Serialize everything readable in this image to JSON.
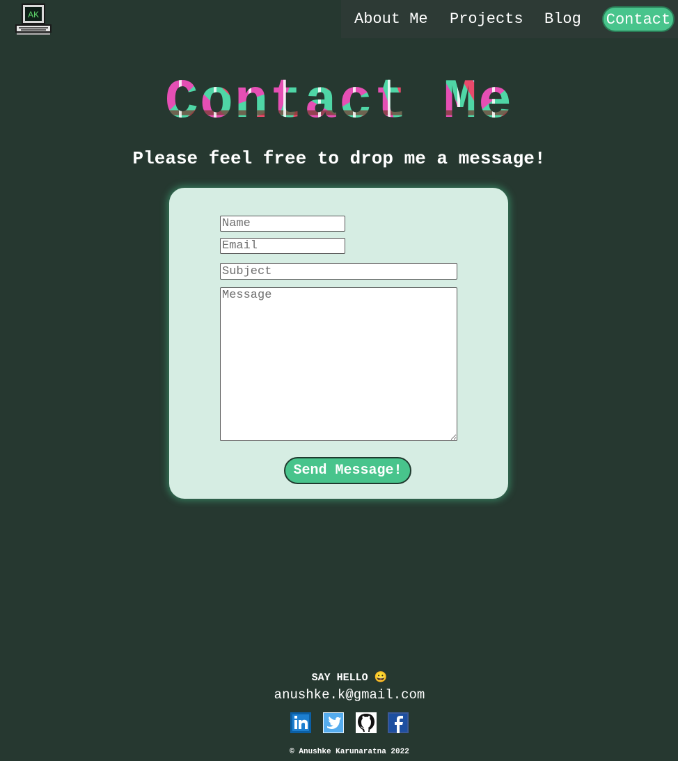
{
  "navbar": {
    "logo_text": "AK",
    "links": [
      {
        "label": "About Me"
      },
      {
        "label": "Projects"
      },
      {
        "label": "Blog"
      },
      {
        "label": "Contact",
        "active": true
      }
    ]
  },
  "hero": {
    "title": "Contact Me",
    "subtitle": "Please feel free to drop me a message!"
  },
  "form": {
    "name_placeholder": "Name",
    "email_placeholder": "Email",
    "subject_placeholder": "Subject",
    "message_placeholder": "Message",
    "submit_label": "Send Message!"
  },
  "footer": {
    "say_hello": "SAY HELLO 😀",
    "email": "anushke.k@gmail.com",
    "social": [
      {
        "icon": "linkedin-icon"
      },
      {
        "icon": "twitter-icon"
      },
      {
        "icon": "github-icon"
      },
      {
        "icon": "facebook-icon"
      }
    ],
    "copyright": "© Anushke Karunaratna 2022"
  },
  "colors": {
    "background": "#263830",
    "accent": "#48c48c",
    "card": "#d6ede3"
  }
}
